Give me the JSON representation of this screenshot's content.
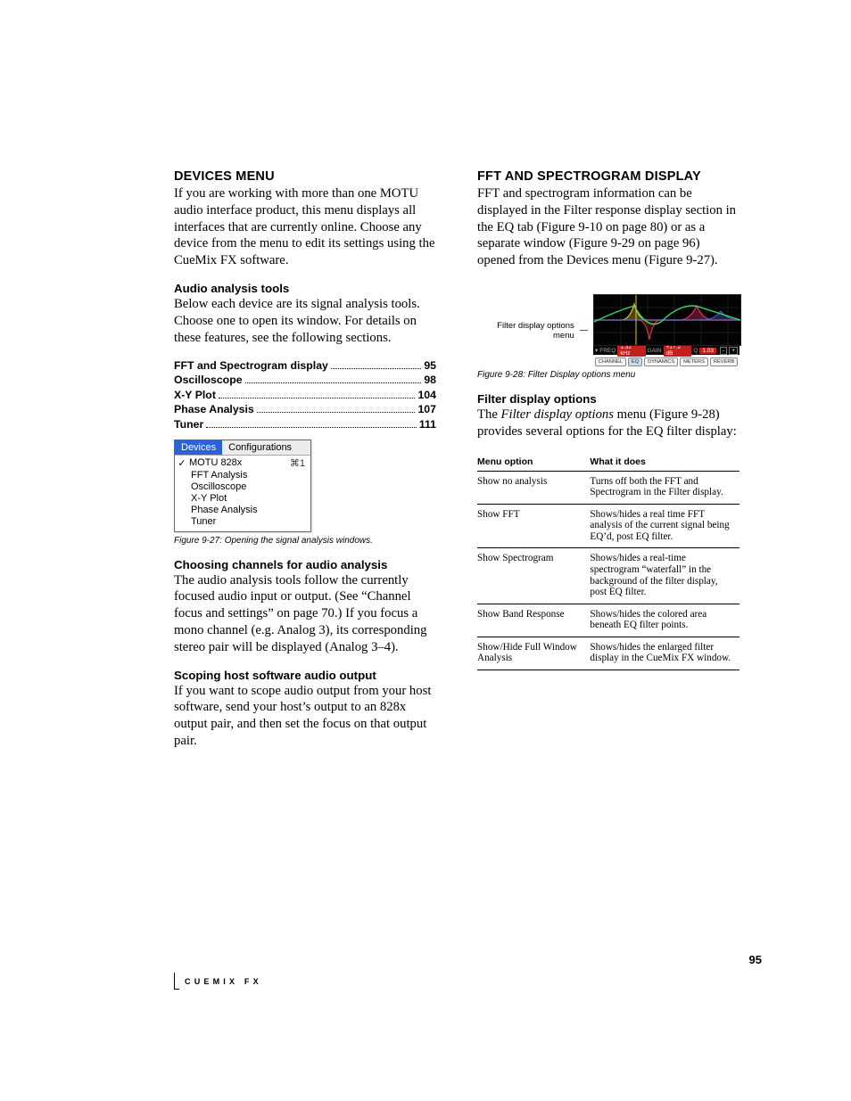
{
  "footer": {
    "section": "CUEMIX FX",
    "page_number": "95"
  },
  "left": {
    "h_devices": "DEVICES MENU",
    "p_devices": "If you are working with more than one MOTU audio interface product, this menu displays all interfaces that are currently online. Choose any device from the menu to edit its settings using the CueMix FX software.",
    "h_audio_tools": "Audio analysis tools",
    "p_audio_tools": "Below each device are its signal analysis tools. Choose one to open its window. For details on these features, see the following sections.",
    "toc": [
      {
        "label": "FFT and Spectrogram display",
        "page": "95"
      },
      {
        "label": "Oscilloscope",
        "page": "98"
      },
      {
        "label": "X-Y Plot",
        "page": "104"
      },
      {
        "label": "Phase Analysis",
        "page": "107"
      },
      {
        "label": "Tuner",
        "page": "111"
      }
    ],
    "menu": {
      "bar": [
        "Devices",
        "Configurations"
      ],
      "device": "MOTU 828x",
      "accel": "⌘1",
      "items": [
        "FFT Analysis",
        "Oscilloscope",
        "X-Y Plot",
        "Phase Analysis",
        "Tuner"
      ]
    },
    "fig927": "Figure 9-27: Opening the signal analysis windows.",
    "h_choosing": "Choosing channels for audio analysis",
    "p_choosing": "The audio analysis tools follow the currently focused audio input or output. (See “Channel focus and settings” on page 70.) If you focus a mono channel (e.g. Analog 3), its corresponding stereo pair will be displayed (Analog 3–4).",
    "h_scoping": "Scoping host software audio output",
    "p_scoping": "If you want to scope audio output from your host software, send your host’s output to an 828x output pair, and then set the focus on that output pair."
  },
  "right": {
    "h_fft": "FFT AND SPECTROGRAM DISPLAY",
    "p_fft": "FFT and spectrogram information can be displayed in the Filter response display section in the EQ tab (Figure 9-10 on page 80) or as a separate window (Figure 9-29 on page 96) opened from the Devices menu (Figure 9-27).",
    "fd_label": "Filter display options menu",
    "status": {
      "freq_lbl": "FREQ",
      "freq": "1.32 kHz",
      "gain_lbl": "GAIN",
      "gain": "+17.2 dB",
      "q_lbl": "Q",
      "q": "1.03"
    },
    "tabs": [
      "CHANNEL",
      "EQ",
      "DYNAMICS",
      "METERS",
      "REVERB"
    ],
    "fig928": "Figure 9-28: Filter Display options menu",
    "h_fdo": "Filter display options",
    "p_fdo_pre": "The ",
    "p_fdo_em": "Filter display options",
    "p_fdo_post": " menu (Figure 9-28) provides several options for the EQ filter display:",
    "table": {
      "h1": "Menu option",
      "h2": "What it does",
      "rows": [
        {
          "opt": "Show no analysis",
          "desc": "Turns off both the FFT and Spectrogram in the Filter display."
        },
        {
          "opt": "Show FFT",
          "desc": "Shows/hides a real time FFT analysis of the current signal being EQ’d, post EQ filter."
        },
        {
          "opt": "Show Spectrogram",
          "desc": "Shows/hides a real-time spectrogram “waterfall” in the background of the filter display, post EQ filter."
        },
        {
          "opt": "Show Band Response",
          "desc": "Shows/hides the colored area beneath EQ filter points."
        },
        {
          "opt": "Show/Hide Full Window Analysis",
          "desc": "Shows/hides the enlarged filter display in the CueMix FX window."
        }
      ]
    }
  }
}
